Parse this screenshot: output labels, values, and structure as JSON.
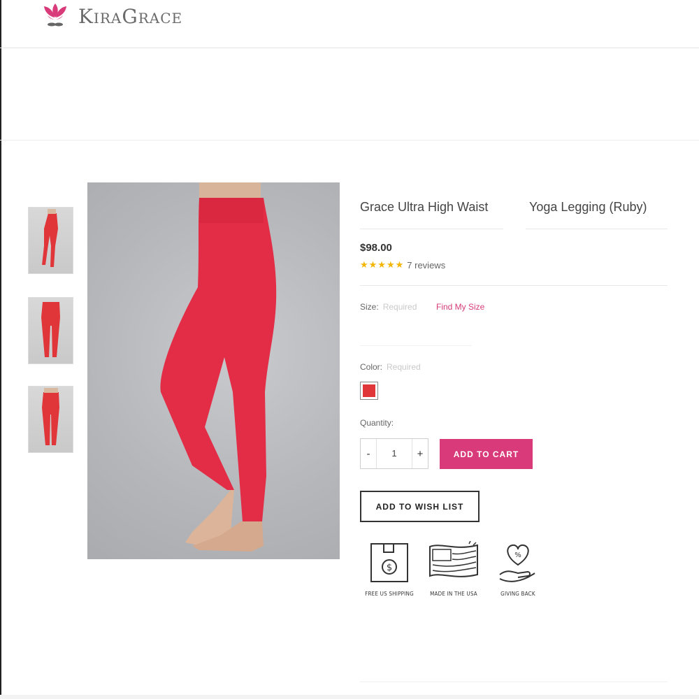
{
  "header": {
    "logo_text": "KiraGrace"
  },
  "gallery": {
    "thumbnails": [
      {
        "view": "side view"
      },
      {
        "view": "front view"
      },
      {
        "view": "front view full"
      }
    ]
  },
  "product": {
    "title_left": "Grace Ultra High Waist",
    "title_right": "Yoga Legging (Ruby)",
    "price": "$98.00",
    "stars": "★★★★★",
    "rating_value": 5,
    "reviews": "7 reviews",
    "size_label": "Size:",
    "size_required": "Required",
    "find_size": "Find My Size",
    "color_label": "Color:",
    "color_required": "Required",
    "swatch_color": "#e0363a",
    "quantity_label": "Quantity:",
    "quantity_value": "1",
    "minus": "-",
    "plus": "+",
    "add_to_cart": "ADD TO CART",
    "add_to_wish_list": "ADD TO WISH LIST"
  },
  "badges": [
    {
      "label": "FREE US SHIPPING",
      "icon": "box-dollar-icon"
    },
    {
      "label": "MADE IN THE USA",
      "icon": "us-flag-icon"
    },
    {
      "label": "GIVING BACK",
      "icon": "heart-hand-icon"
    }
  ],
  "colors": {
    "accent": "#d93b7a",
    "legging": "#e0363a",
    "stars": "#f2b600"
  }
}
